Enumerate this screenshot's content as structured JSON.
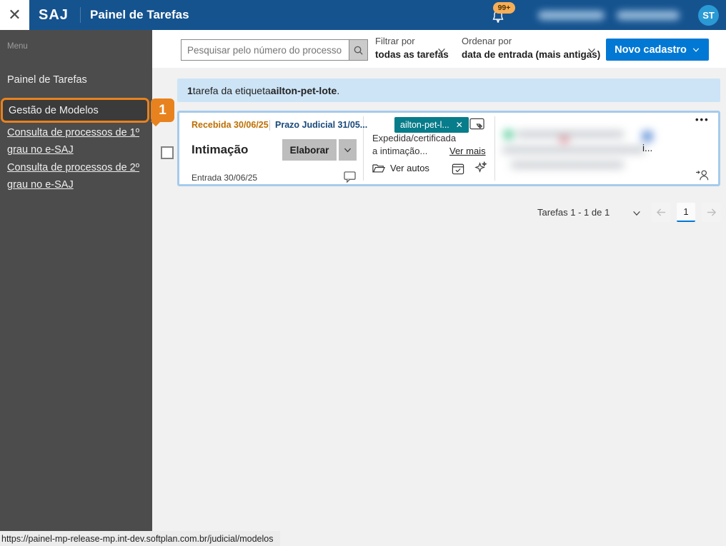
{
  "topbar": {
    "close_icon": "✕",
    "brand": "SAJ",
    "title": "Painel de Tarefas",
    "notification_count": "99+",
    "avatar_initials": "ST"
  },
  "sidebar": {
    "menu_label": "Menu",
    "items": [
      {
        "label": "Painel de Tarefas"
      },
      {
        "label": "Gestão de Modelos",
        "annotation_badge": "1"
      },
      {
        "label": "Consulta de processos de 1º grau no e-SAJ"
      },
      {
        "label": "Consulta de processos de 2º grau no e-SAJ"
      }
    ]
  },
  "toolbar": {
    "search_placeholder": "Pesquisar pelo número do processo",
    "filter_label": "Filtrar por",
    "filter_value": "todas as tarefas",
    "sort_label": "Ordenar por",
    "sort_value": "data de entrada (mais antigas)",
    "new_button_label": "Novo cadastro"
  },
  "banner": {
    "count": "1",
    "middle": " tarefa da etiqueta ",
    "tag": "ailton-pet-lote",
    "period": "."
  },
  "task_card": {
    "received": "Recebida 30/06/25",
    "deadline": "Prazo Judicial 31/05...",
    "tag_label": "ailton-pet-l...",
    "tag_close_icon": "✕",
    "title": "Intimação",
    "action_button": "Elaborar",
    "movement_line1": "Expedida/certificada",
    "movement_line2": "a intimação...",
    "see_more_link": "Ver mais",
    "ver_autos_link": "Ver autos",
    "entry": "Entrada 30/06/25",
    "truncated_text": "i...",
    "more_icon": "•••"
  },
  "pagination": {
    "summary": "Tarefas 1 - 1 de 1",
    "current_page": "1"
  },
  "statusbar": {
    "url": "https://painel-mp-release-mp.int-dev.softplan.com.br/judicial/modelos"
  },
  "colors": {
    "topbar_blue": "#15538f",
    "accent_blue": "#0078d4",
    "avatar_blue": "#2a9ad5",
    "annotation_orange": "#e8821e",
    "tag_teal": "#077c8a",
    "received_amber": "#bd6f00",
    "deadline_navy": "#17497a",
    "banner_blue": "#cde4f6",
    "card_border_blue": "#a5cbec",
    "sidebar_gray": "#4c4c4c",
    "notification_badge": "#f6ae57"
  }
}
